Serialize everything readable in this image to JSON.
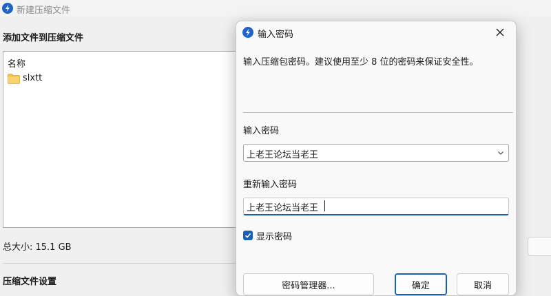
{
  "main_window": {
    "title": "新建压缩文件",
    "add_files_heading": "添加文件到压缩文件",
    "file_list": {
      "column_header": "名称",
      "items": [
        {
          "name": "slxtt",
          "icon": "folder-icon"
        }
      ]
    },
    "total_size": "总大小: 15.1 GB",
    "settings_heading": "压缩文件设置"
  },
  "password_dialog": {
    "title": "输入密码",
    "description": "输入压缩包密码。建议使用至少 8 位的密码来保证安全性。",
    "password_label": "输入密码",
    "password_value": "上老王论坛当老王",
    "confirm_label": "重新输入密码",
    "confirm_value": "上老王论坛当老王",
    "show_password_label": "显示密码",
    "show_password_checked": true,
    "buttons": {
      "manager": "密码管理器...",
      "ok": "确定",
      "cancel": "取消"
    }
  },
  "colors": {
    "accent": "#1a5fb4",
    "logo": "#1f64c8",
    "folder": "#f4c34a",
    "window_bg": "#f0f0f0"
  }
}
